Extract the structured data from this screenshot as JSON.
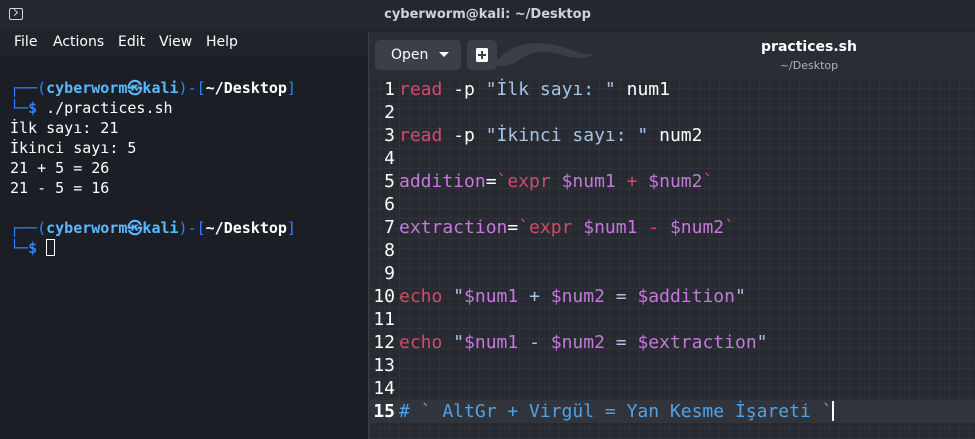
{
  "terminal": {
    "title": "cyberworm@kali: ~/Desktop",
    "menu": [
      "File",
      "Actions",
      "Edit",
      "View",
      "Help"
    ],
    "prompt": {
      "user": "cyberworm",
      "at_glyph": "㉿",
      "host": "kali",
      "path": "~/Desktop",
      "dollar": "$",
      "top_prefix": "┌──(",
      "mid": ")-[",
      "end": "]",
      "bottom_prefix": "└─"
    },
    "command": " ./practices.sh",
    "output": [
      "İlk sayı: 21",
      "İkinci sayı: 5",
      "21 + 5 = 26",
      "21 - 5 = 16"
    ]
  },
  "editor": {
    "open_label": "Open",
    "filename": "practices.sh",
    "filepath": "~/Desktop",
    "lines": [
      {
        "n": "1",
        "parts": [
          {
            "t": "read",
            "c": "k"
          },
          {
            "t": " -p ",
            "c": ""
          },
          {
            "t": "\"İlk sayı: \"",
            "c": "s"
          },
          {
            "t": " num1",
            "c": ""
          }
        ]
      },
      {
        "n": "2",
        "parts": []
      },
      {
        "n": "3",
        "parts": [
          {
            "t": "read",
            "c": "k"
          },
          {
            "t": " -p ",
            "c": ""
          },
          {
            "t": "\"İkinci sayı: \"",
            "c": "s"
          },
          {
            "t": " num2",
            "c": ""
          }
        ]
      },
      {
        "n": "4",
        "parts": []
      },
      {
        "n": "5",
        "parts": [
          {
            "t": "addition",
            "c": "v"
          },
          {
            "t": "=",
            "c": ""
          },
          {
            "t": "`expr ",
            "c": "bt"
          },
          {
            "t": "$num1",
            "c": "v"
          },
          {
            "t": " + ",
            "c": "bt"
          },
          {
            "t": "$num2",
            "c": "v"
          },
          {
            "t": "`",
            "c": "bt"
          }
        ]
      },
      {
        "n": "6",
        "parts": []
      },
      {
        "n": "7",
        "parts": [
          {
            "t": "extraction",
            "c": "v"
          },
          {
            "t": "=",
            "c": ""
          },
          {
            "t": "`expr ",
            "c": "bt"
          },
          {
            "t": "$num1",
            "c": "v"
          },
          {
            "t": " - ",
            "c": "bt"
          },
          {
            "t": "$num2",
            "c": "v"
          },
          {
            "t": "`",
            "c": "bt"
          }
        ]
      },
      {
        "n": "8",
        "parts": []
      },
      {
        "n": "9",
        "parts": []
      },
      {
        "n": "10",
        "parts": [
          {
            "t": "echo",
            "c": "k"
          },
          {
            "t": " \"",
            "c": "s"
          },
          {
            "t": "$num1",
            "c": "v"
          },
          {
            "t": " + ",
            "c": "s"
          },
          {
            "t": "$num2",
            "c": "v"
          },
          {
            "t": " = ",
            "c": "s"
          },
          {
            "t": "$addition",
            "c": "v"
          },
          {
            "t": "\"",
            "c": "s"
          }
        ]
      },
      {
        "n": "11",
        "parts": []
      },
      {
        "n": "12",
        "parts": [
          {
            "t": "echo",
            "c": "k"
          },
          {
            "t": " \"",
            "c": "s"
          },
          {
            "t": "$num1",
            "c": "v"
          },
          {
            "t": " - ",
            "c": "s"
          },
          {
            "t": "$num2",
            "c": "v"
          },
          {
            "t": " = ",
            "c": "s"
          },
          {
            "t": "$extraction",
            "c": "v"
          },
          {
            "t": "\"",
            "c": "s"
          }
        ]
      },
      {
        "n": "13",
        "parts": []
      },
      {
        "n": "14",
        "parts": []
      },
      {
        "n": "15",
        "parts": [
          {
            "t": "# ` AltGr + Virgül = Yan Kesme İşareti `",
            "c": "cm"
          }
        ]
      }
    ],
    "current_line": "15"
  },
  "colors": {
    "keyword": "#d44a6a",
    "string": "#a7c4e8",
    "variable": "#c678dd",
    "comment": "#4fa3e8",
    "prompt_blue": "#2f80ff",
    "prompt_cyan": "#5bb9ff"
  },
  "icons": {
    "terminal": "terminal-icon",
    "new_tab": "new-document-icon",
    "open_caret": "chevron-down-icon"
  }
}
